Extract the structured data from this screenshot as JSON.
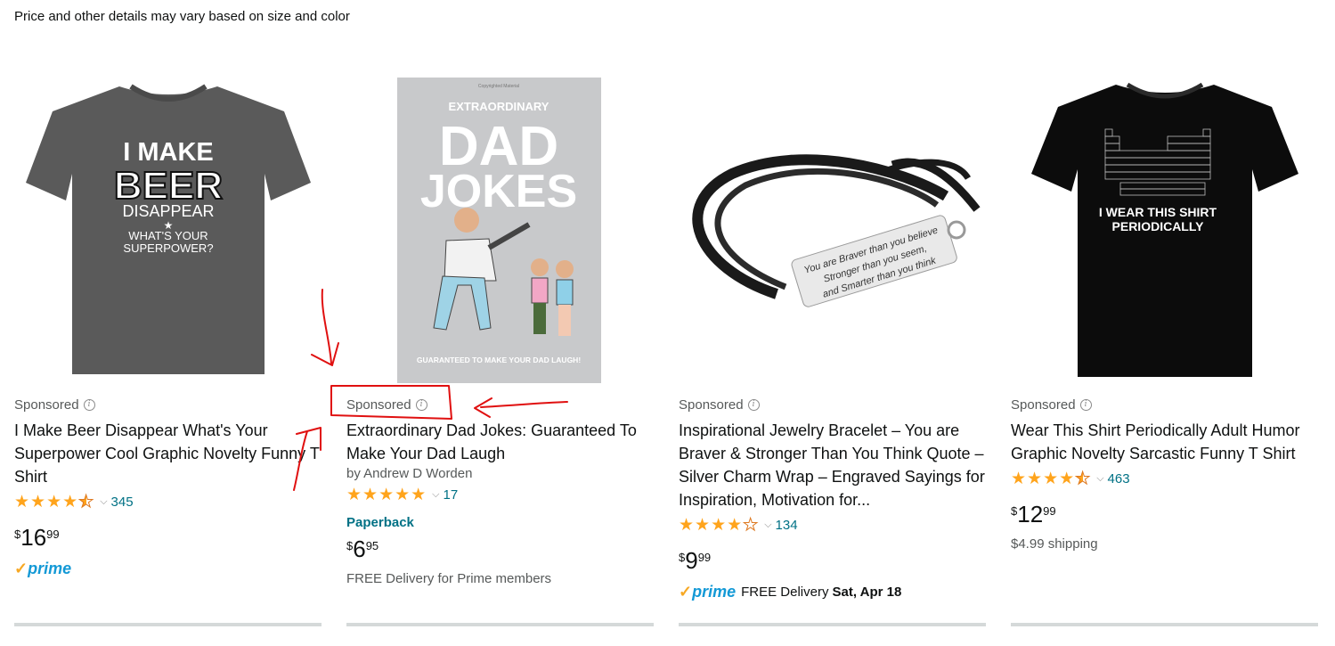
{
  "notice": "Price and other details may vary based on size and color",
  "products": [
    {
      "sponsored_label": "Sponsored",
      "title": "I Make Beer Disappear What's Your Superpower Cool Graphic Novelty Funny T Shirt",
      "rating": 4.5,
      "rating_count": "345",
      "price": {
        "symbol": "$",
        "whole": "16",
        "fraction": "99"
      },
      "prime": true,
      "image_text": [
        "I MAKE",
        "BEER",
        "DISAPPEAR",
        "WHAT'S YOUR",
        "SUPERPOWER?"
      ]
    },
    {
      "sponsored_label": "Sponsored",
      "title": "Extraordinary Dad Jokes: Guaranteed To Make Your Dad Laugh",
      "byline": "by Andrew D Worden",
      "rating": 5,
      "rating_count": "17",
      "format": "Paperback",
      "price": {
        "symbol": "$",
        "whole": "6",
        "fraction": "95"
      },
      "shipping": "FREE Delivery for Prime members",
      "image_text": [
        "Copyrighted Material",
        "EXTRAORDINARY",
        "DAD",
        "JOKES",
        "GUARANTEED TO MAKE YOUR DAD LAUGH!"
      ]
    },
    {
      "sponsored_label": "Sponsored",
      "title": "Inspirational Jewelry Bracelet – You are Braver & Stronger Than You Think Quote – Silver Charm Wrap – Engraved Sayings for Inspiration, Motivation for...",
      "rating": 4,
      "rating_count": "134",
      "price": {
        "symbol": "$",
        "whole": "9",
        "fraction": "99"
      },
      "prime": true,
      "delivery_text": "FREE Delivery",
      "delivery_date": "Sat, Apr 18",
      "image_text": [
        "You are Braver than you believe",
        "Stronger than you seem,",
        "and Smarter than you think"
      ]
    },
    {
      "sponsored_label": "Sponsored",
      "title": "Wear This Shirt Periodically Adult Humor Graphic Novelty Sarcastic Funny T Shirt",
      "rating": 4.5,
      "rating_count": "463",
      "price": {
        "symbol": "$",
        "whole": "12",
        "fraction": "99"
      },
      "shipping": "$4.99 shipping",
      "image_text": [
        "I WEAR THIS SHIRT",
        "PERIODICALLY"
      ]
    }
  ],
  "prime_label": "prime",
  "colors": {
    "link": "#007185",
    "star": "#ffa41c",
    "prime": "#1399d6",
    "annotation": "#e01010"
  }
}
